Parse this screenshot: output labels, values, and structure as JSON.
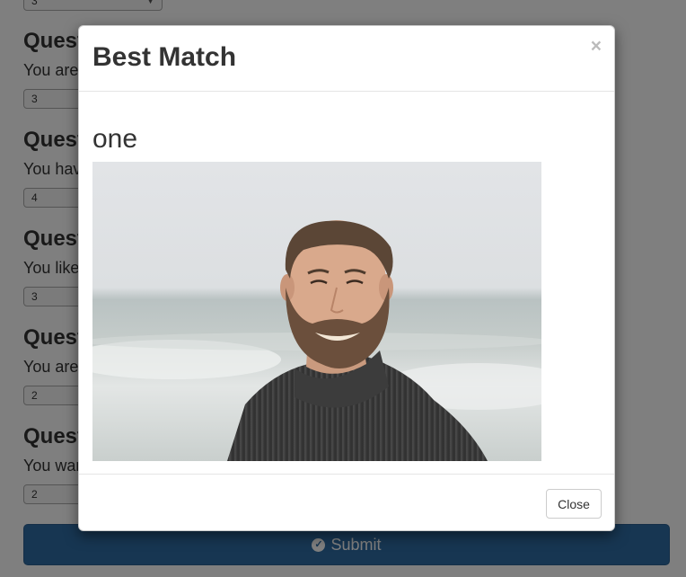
{
  "form": {
    "top_select_value": "3",
    "questions": [
      {
        "title": "Question",
        "text": "You are",
        "value": "3"
      },
      {
        "title": "Question",
        "text": "You have",
        "value": "4"
      },
      {
        "title": "Question",
        "text": "You like",
        "value": "3"
      },
      {
        "title": "Question",
        "text": "You are",
        "value": "2"
      },
      {
        "title": "Question",
        "text": "You want",
        "value": "2"
      }
    ],
    "submit_label": "Submit",
    "submit_icon": "check-circle-icon"
  },
  "modal": {
    "title": "Best Match",
    "close_glyph": "×",
    "match_name": "one",
    "photo": "portrait of a smiling bearded man in a dark sweater by the sea",
    "close_button": "Close"
  },
  "colors": {
    "primary": "#2e6da4",
    "backdrop": "rgba(0,0,0,0.5)"
  }
}
